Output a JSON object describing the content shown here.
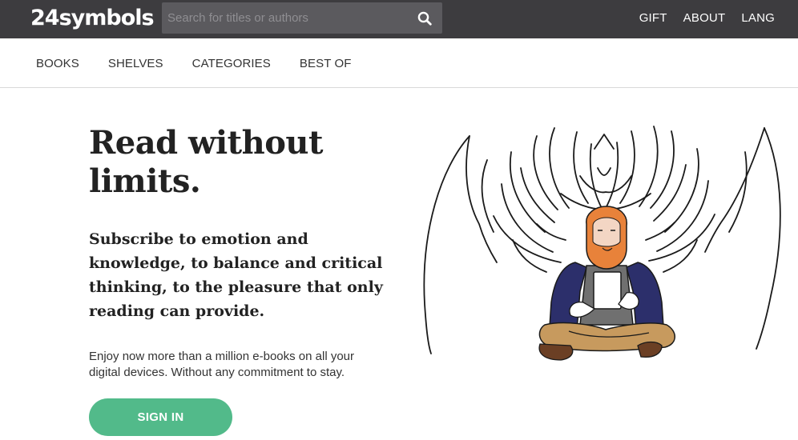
{
  "header": {
    "logo_text": "24symbols",
    "search_placeholder": "Search for titles or authors",
    "search_icon": "search-icon",
    "nav": [
      "GIFT",
      "ABOUT",
      "LANG"
    ]
  },
  "subnav": {
    "items": [
      "BOOKS",
      "SHELVES",
      "CATEGORIES",
      "BEST OF"
    ]
  },
  "hero": {
    "title_line1": "Read without",
    "title_line2": "limits.",
    "subtitle": "Subscribe to emotion and knowledge, to balance and critical thinking, to the pleasure that only reading can provide.",
    "description": "Enjoy now more than a million e-books on all your digital devices. Without any commitment to stay.",
    "signin_label": "SIGN IN"
  },
  "colors": {
    "topbar": "#3d3c3f",
    "search_bg": "#5b5a5e",
    "accent_green": "#52ba8a",
    "beard_orange": "#e8823a",
    "jacket_navy": "#2c2f6b",
    "pants_tan": "#c79a5e",
    "shoes_brown": "#6b3f24"
  }
}
